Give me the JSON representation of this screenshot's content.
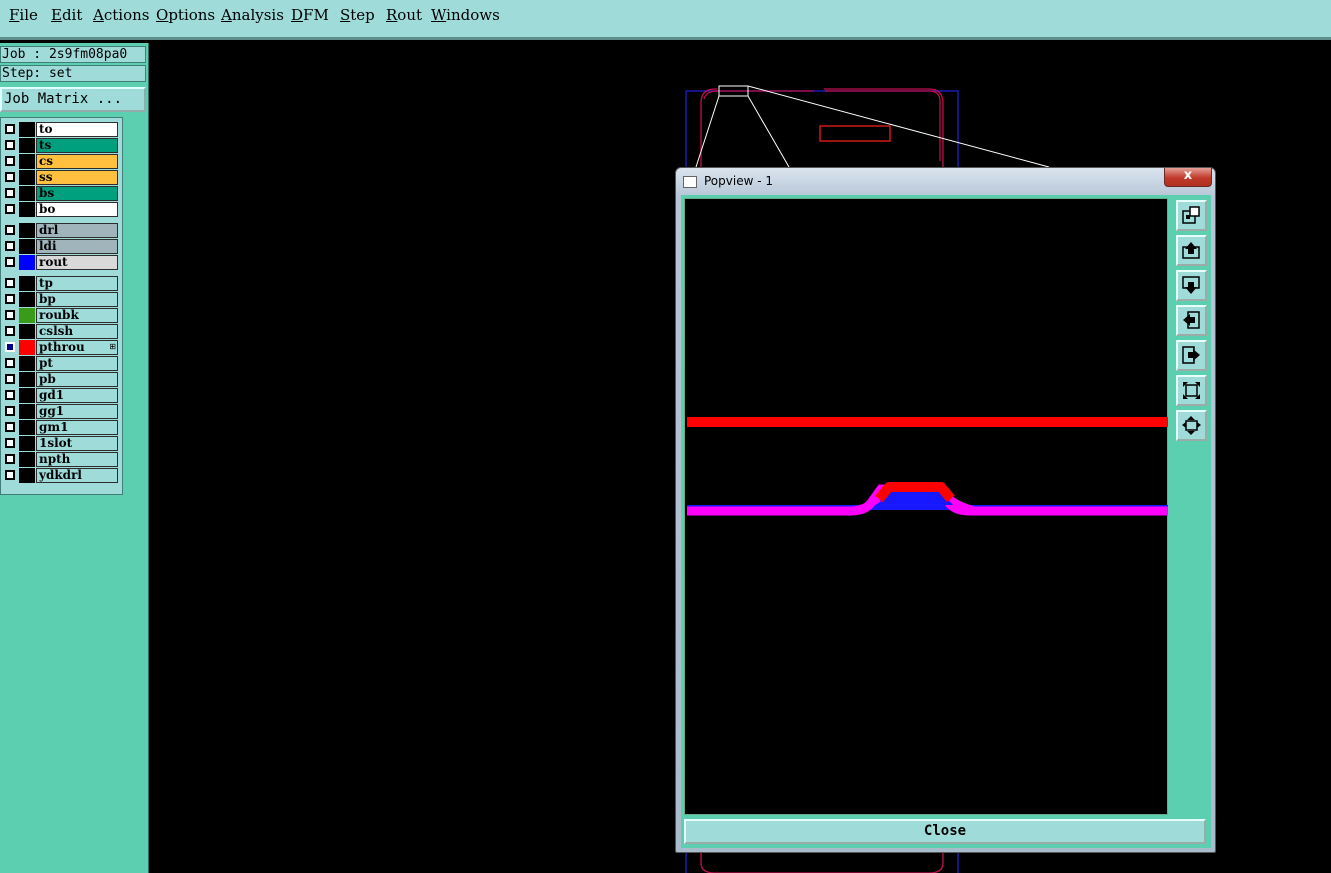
{
  "menu": [
    "File",
    "Edit",
    "Actions",
    "Options",
    "Analysis",
    "DFM",
    "Step",
    "Rout",
    "Windows"
  ],
  "job": {
    "job_text": "Job : 2s9fm08pa0",
    "step_text": "Step: set",
    "matrix_label": "Job Matrix ..."
  },
  "layers": [
    {
      "name": "to",
      "color": "#ffffff",
      "swatch": "#000000"
    },
    {
      "name": "ts",
      "color": "#00a07e",
      "swatch": "#000000"
    },
    {
      "name": "cs",
      "color": "#ffc040",
      "swatch": "#000000"
    },
    {
      "name": "ss",
      "color": "#ffc040",
      "swatch": "#000000"
    },
    {
      "name": "bs",
      "color": "#00a07e",
      "swatch": "#000000"
    },
    {
      "name": "bo",
      "color": "#ffffff",
      "swatch": "#000000"
    },
    {
      "name": "drl",
      "color": "#a0b4bc",
      "swatch": "#000000"
    },
    {
      "name": "ldi",
      "color": "#a0b4bc",
      "swatch": "#000000"
    },
    {
      "name": "rout",
      "color": "#d9d9d9",
      "swatch": "#0000ff"
    },
    {
      "name": "tp",
      "color": "#9fdcd9",
      "swatch": "#000000"
    },
    {
      "name": "bp",
      "color": "#9fdcd9",
      "swatch": "#000000"
    },
    {
      "name": "roubk",
      "color": "#9fdcd9",
      "swatch": "#3a9a1a"
    },
    {
      "name": "cslsh",
      "color": "#9fdcd9",
      "swatch": "#000000"
    },
    {
      "name": "pthrou",
      "color": "#9fdcd9",
      "swatch": "#ff0000",
      "selected": true,
      "mark": "⊞"
    },
    {
      "name": "pt",
      "color": "#9fdcd9",
      "swatch": "#000000"
    },
    {
      "name": "pb",
      "color": "#9fdcd9",
      "swatch": "#000000"
    },
    {
      "name": "gd1",
      "color": "#9fdcd9",
      "swatch": "#000000"
    },
    {
      "name": "gg1",
      "color": "#9fdcd9",
      "swatch": "#000000"
    },
    {
      "name": "gm1",
      "color": "#9fdcd9",
      "swatch": "#000000"
    },
    {
      "name": "1slot",
      "color": "#9fdcd9",
      "swatch": "#000000"
    },
    {
      "name": "npth",
      "color": "#9fdcd9",
      "swatch": "#000000"
    },
    {
      "name": "ydkdrl",
      "color": "#9fdcd9",
      "swatch": "#000000"
    }
  ],
  "popview": {
    "title": "Popview - 1",
    "close_x": "x",
    "close_label": "Close"
  },
  "tools": [
    "zoom-window-icon",
    "pan-up-icon",
    "pan-down-icon",
    "pan-left-icon",
    "pan-right-icon",
    "zoom-fit-icon",
    "zoom-home-icon"
  ],
  "colors": {
    "accent_panel": "#5ccfb0",
    "menu_bg": "#9fdcd9"
  }
}
